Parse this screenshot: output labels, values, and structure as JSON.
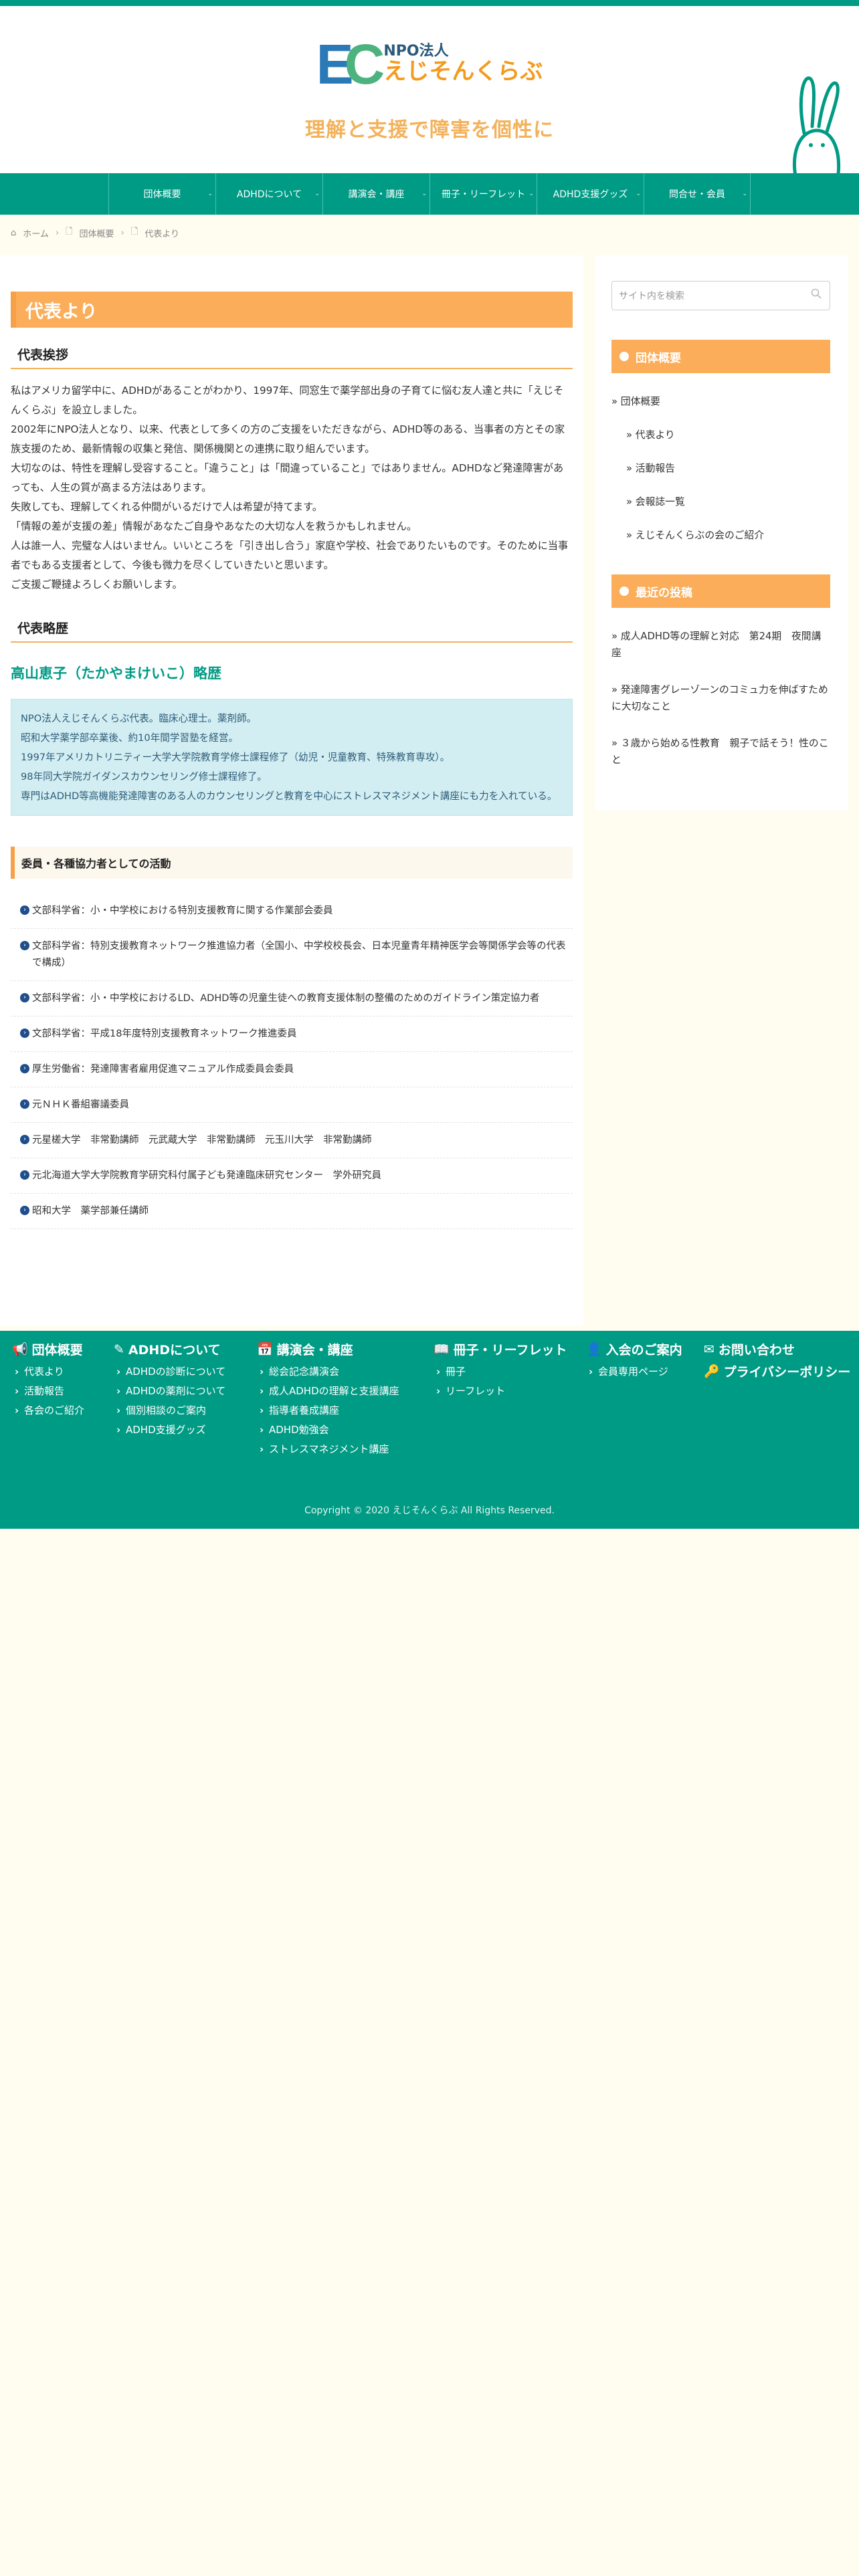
{
  "site": {
    "logo_mark": "EC",
    "logo_npo": "NPO法人",
    "logo_name": "えじそんくらぶ",
    "tagline": "理解と支援で障害を個性に",
    "colors": {
      "primary": "#009b85",
      "accent": "#fbad59",
      "link": "#009b85"
    }
  },
  "nav": {
    "items": [
      {
        "label": "団体概要",
        "has_dropdown": true
      },
      {
        "label": "ADHDについて",
        "has_dropdown": true
      },
      {
        "label": "講演会・講座",
        "has_dropdown": true
      },
      {
        "label": "冊子・リーフレット",
        "has_dropdown": true
      },
      {
        "label": "ADHD支援グッズ",
        "has_dropdown": true
      },
      {
        "label": "問合せ・会員",
        "has_dropdown": true
      }
    ]
  },
  "breadcrumb": {
    "home": "ホーム",
    "level1": "団体概要",
    "current": "代表より"
  },
  "main": {
    "title": "代表より",
    "greeting_heading": "代表挨拶",
    "greeting_paragraphs": [
      "私はアメリカ留学中に、ADHDがあることがわかり、1997年、同窓生で薬学部出身の子育てに悩む友人達と共に「えじそんくらぶ」を設立しました。",
      "2002年にNPO法人となり、以来、代表として多くの方のご支援をいただきながら、ADHD等のある、当事者の方とその家族支援のため、最新情報の収集と発信、関係機関との連携に取り組んでいます。",
      "大切なのは、特性を理解し受容すること。「違うこと」は「間違っていること」ではありません。ADHDなど発達障害があっても、人生の質が高まる方法はあります。",
      "失敗しても、理解してくれる仲間がいるだけで人は希望が持てます。",
      "「情報の差が支援の差」情報があなたご自身やあなたの大切な人を救うかもしれません。",
      "人は誰一人、完璧な人はいません。いいところを「引き出し合う」家庭や学校、社会でありたいものです。そのために当事者でもある支援者として、今後も微力を尽くしていきたいと思います。",
      "ご支援ご鞭撻よろしくお願いします。"
    ],
    "profile_heading": "代表略歴",
    "person_name": "高山恵子（たかやまけいこ）略歴",
    "profile_lines": [
      "NPO法人えじそんくらぶ代表。臨床心理士。薬剤師。",
      "昭和大学薬学部卒業後、約10年間学習塾を経営。",
      "1997年アメリカトリニティー大学大学院教育学修士課程修了（幼児・児童教育、特殊教育専攻）。",
      "98年同大学院ガイダンスカウンセリング修士課程修了。",
      "専門はADHD等高機能発達障害のある人のカウンセリングと教育を中心にストレスマネジメント講座にも力を入れている。"
    ],
    "activities_heading": "委員・各種協力者としての活動",
    "activities": [
      "文部科学省：小・中学校における特別支援教育に関する作業部会委員",
      "文部科学省：特別支援教育ネットワーク推進協力者（全国小、中学校校長会、日本児童青年精神医学会等関係学会等の代表で構成）",
      "文部科学省：小・中学校におけるLD、ADHD等の児童生徒への教育支援体制の整備のためのガイドライン策定協力者",
      "文部科学省：平成18年度特別支援教育ネットワーク推進委員",
      "厚生労働省：発達障害者雇用促進マニュアル作成委員会委員",
      "元ＮＨＫ番組審議委員",
      "元星槎大学　非常勤講師　元武蔵大学　非常勤講師　元玉川大学　非常勤講師",
      "元北海道大学大学院教育学研究科付属子ども発達臨床研究センター　学外研究員",
      "昭和大学　薬学部兼任講師"
    ]
  },
  "sidebar": {
    "search_placeholder": "サイト内を検索",
    "widget1_title": "団体概要",
    "widget1_top": "団体概要",
    "widget1_sub": [
      "代表より",
      "活動報告",
      "会報誌一覧",
      "えじそんくらぶの会のご紹介"
    ],
    "widget2_title": "最近の投稿",
    "recent_posts": [
      "成人ADHD等の理解と対応　第24期　夜間講座",
      "発達障害グレーゾーンのコミュ力を伸ばすために大切なこと",
      "３歳から始める性教育　親子で話そう！性のこと"
    ]
  },
  "footer": {
    "columns": [
      {
        "icon": "megaphone-icon",
        "heading": "団体概要",
        "items": [
          "代表より",
          "活動報告",
          "各会のご紹介"
        ]
      },
      {
        "icon": "edit-icon",
        "heading": "ADHDについて",
        "items": [
          "ADHDの診断について",
          "ADHDの薬剤について",
          "個別相談のご案内",
          "ADHD支援グッズ"
        ]
      },
      {
        "icon": "calendar-icon",
        "heading": "講演会・講座",
        "items": [
          "総会記念講演会",
          "成人ADHDの理解と支援講座",
          "指導者養成講座",
          "ADHD勉強会",
          "ストレスマネジメント講座"
        ]
      },
      {
        "icon": "book-icon",
        "heading": "冊子・リーフレット",
        "items": [
          "冊子",
          "リーフレット"
        ]
      },
      {
        "icon": "user-plus-icon",
        "heading": "入会のご案内",
        "items": [
          "会員専用ページ"
        ]
      },
      {
        "icon": "mail-icon",
        "heading": "お問い合わせ",
        "items": []
      }
    ],
    "privacy_label": "プライバシーポリシー",
    "copyright": "Copyright © 2020 えじそんくらぶ All Rights Reserved."
  }
}
